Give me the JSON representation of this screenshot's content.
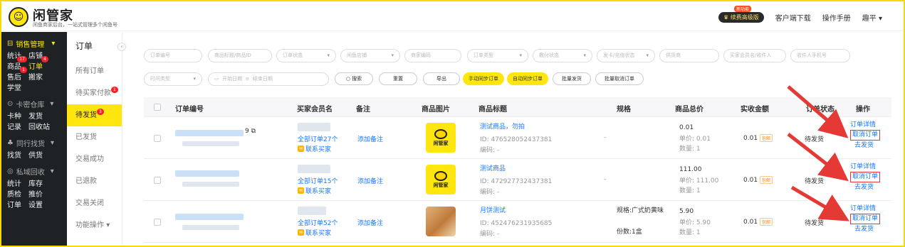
{
  "brand": {
    "title": "闲管家",
    "subtitle": "闲鱼商家后台，一站式管理多个闲鱼号",
    "logo_icon": "smile-logo-icon"
  },
  "topbar": {
    "vip_badge": "续费高级版",
    "vip_new_tag": "新功能",
    "download": "客户端下载",
    "manual": "操作手册",
    "user": "趣平"
  },
  "sidebar": {
    "sections": [
      {
        "title": "销售管理",
        "rows": [
          [
            "统计",
            "店铺"
          ],
          [
            "商品",
            "订单"
          ],
          [
            "售后",
            "搬家"
          ],
          [
            "学堂"
          ]
        ]
      },
      {
        "title": "卡密仓库",
        "rows": [
          [
            "卡种",
            "发货"
          ],
          [
            "记录",
            "回收站"
          ]
        ]
      },
      {
        "title": "同行找货",
        "rows": [
          [
            "找货",
            "供货"
          ]
        ]
      },
      {
        "title": "私域回收",
        "rows": [
          [
            "统计",
            "库存"
          ],
          [
            "质检",
            "推价"
          ],
          [
            "订单",
            "设置"
          ]
        ]
      }
    ],
    "badges": {
      "goods": "17",
      "orders": "4",
      "aftersale": "1"
    }
  },
  "subnav": {
    "head": "订单",
    "items": [
      {
        "label": "所有订单"
      },
      {
        "label": "待买家付款",
        "badge": "1"
      },
      {
        "label": "待发货",
        "badge": "3"
      },
      {
        "label": "已发货"
      },
      {
        "label": "交易成功"
      },
      {
        "label": "已退款"
      },
      {
        "label": "交易关闭"
      },
      {
        "label": "功能操作"
      }
    ]
  },
  "filters": {
    "row1": [
      "订单编号",
      "商品标题/商品ID",
      "订单状态",
      "闲鱼店铺",
      "商家编码",
      "订单类型",
      "敷付状态",
      "发卡/充值状态",
      "供货商",
      "买家会员名/收件人",
      "收件人手机号"
    ],
    "time_type": "时间类型",
    "start_date": "开始日期",
    "end_date": "结束日期",
    "buttons": [
      "○ 搜索",
      "重置",
      "导出",
      "手动同步订单",
      "自动同步订单",
      "批量发货",
      "批量取消订单"
    ]
  },
  "table": {
    "headers": [
      "订单编号",
      "买家会员名",
      "备注",
      "商品图片",
      "商品标题",
      "规格",
      "商品总价",
      "实收金额",
      "订单状态",
      "操作"
    ],
    "rows": [
      {
        "order_suffix": "9",
        "buyer_orders": "全部订单27个",
        "contact": "联系买家",
        "note": "添加备注",
        "title": "测试商品，勿拍",
        "id": "ID: 476528052437381",
        "code": "编码: -",
        "spec": "-",
        "spec2": "",
        "total": "0.01",
        "unit": "单价: 0.01",
        "qty": "数量: 1",
        "paid": "0.01",
        "paid_tag": "包邮",
        "status": "待发货",
        "op1": "订单详情",
        "op2": "取消订单",
        "op3": "去发货",
        "img": "logo"
      },
      {
        "order_suffix": "",
        "buyer_orders": "全部订单15个",
        "contact": "联系买家",
        "note": "添加备注",
        "title": "测试商品",
        "id": "ID: 472927732437381",
        "code": "编码: -",
        "spec": "-",
        "spec2": "",
        "total": "111.00",
        "unit": "单价: 111.00",
        "qty": "数量: 1",
        "paid": "0.01",
        "paid_tag": "包邮",
        "status": "待发货",
        "op1": "订单详情",
        "op2": "取消订单",
        "op3": "去发货",
        "img": "logo"
      },
      {
        "order_suffix": "",
        "buyer_orders": "全部订单52个",
        "contact": "联系买家",
        "note": "添加备注",
        "title": "月饼测试",
        "id": "ID: 452476231935685",
        "code": "编码: -",
        "spec": "规格:广式奶黄味",
        "spec2": "份数:1盒",
        "total": "5.90",
        "unit": "单价: 5.90",
        "qty": "数量: 1",
        "paid": "0.01",
        "paid_tag": "包邮",
        "status": "待发货",
        "op1": "订单详情",
        "op2": "取消订单",
        "op3": "去发货",
        "img": "cat"
      }
    ]
  },
  "goods_logo_text": "闲管家",
  "colors": {
    "accent": "#ffe60f",
    "sidebar_bg": "#1f2224",
    "link": "#1677ff",
    "highlight": "#e53935"
  }
}
